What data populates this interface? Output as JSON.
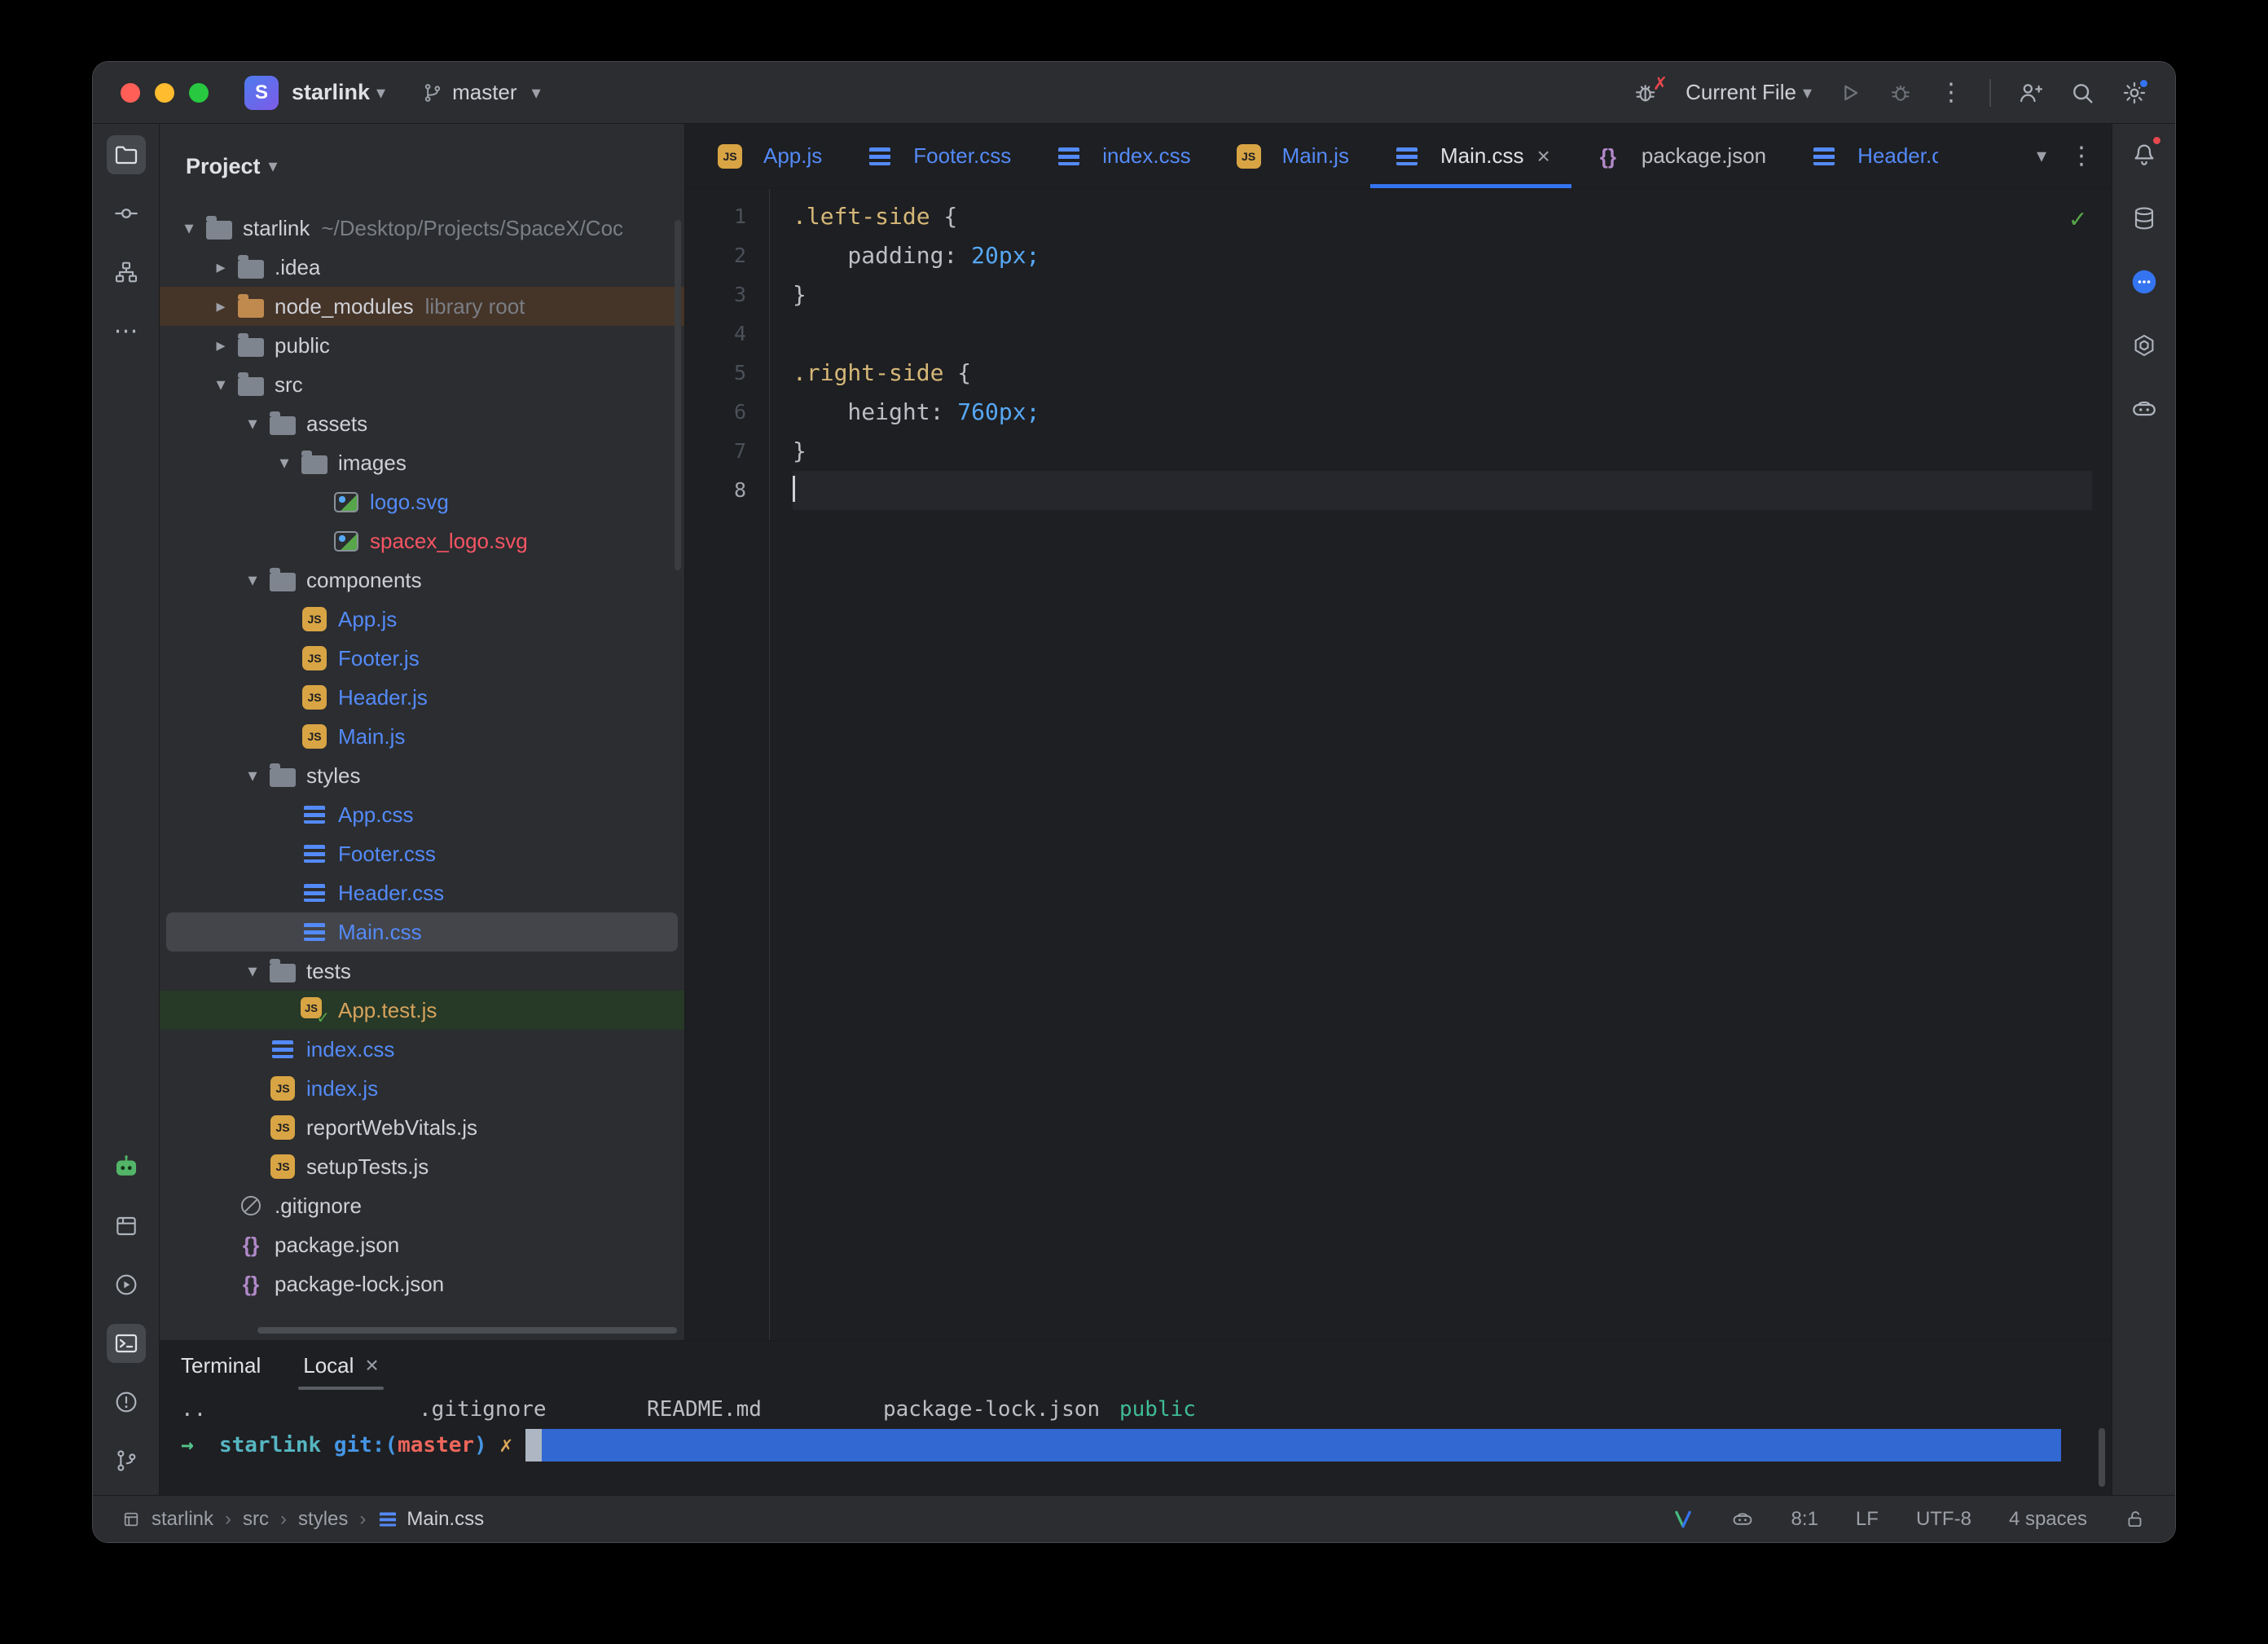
{
  "titlebar": {
    "project_initial": "S",
    "project_name": "starlink",
    "branch_name": "master",
    "run_config": "Current File"
  },
  "project_panel": {
    "title": "Project",
    "tree": [
      {
        "label": "starlink",
        "suffix": "~/Desktop/Projects/SpaceX/Coc"
      },
      {
        "label": ".idea"
      },
      {
        "label": "node_modules",
        "suffix": "library root"
      },
      {
        "label": "public"
      },
      {
        "label": "src"
      },
      {
        "label": "assets"
      },
      {
        "label": "images"
      },
      {
        "label": "logo.svg"
      },
      {
        "label": "spacex_logo.svg"
      },
      {
        "label": "components"
      },
      {
        "label": "App.js"
      },
      {
        "label": "Footer.js"
      },
      {
        "label": "Header.js"
      },
      {
        "label": "Main.js"
      },
      {
        "label": "styles"
      },
      {
        "label": "App.css"
      },
      {
        "label": "Footer.css"
      },
      {
        "label": "Header.css"
      },
      {
        "label": "Main.css"
      },
      {
        "label": "tests"
      },
      {
        "label": "App.test.js"
      },
      {
        "label": "index.css"
      },
      {
        "label": "index.js"
      },
      {
        "label": "reportWebVitals.js"
      },
      {
        "label": "setupTests.js"
      },
      {
        "label": ".gitignore"
      },
      {
        "label": "package.json"
      },
      {
        "label": "package-lock.json"
      }
    ]
  },
  "tabs": [
    {
      "label": "App.js"
    },
    {
      "label": "Footer.css"
    },
    {
      "label": "index.css"
    },
    {
      "label": "Main.js"
    },
    {
      "label": "Main.css"
    },
    {
      "label": "package.json"
    },
    {
      "label": "Header.cs"
    }
  ],
  "editor": {
    "line_numbers": [
      "1",
      "2",
      "3",
      "4",
      "5",
      "6",
      "7",
      "8"
    ],
    "code": {
      "selector_1": ".left-side",
      "open_brace_1": "{",
      "property_1": "padding:",
      "value_1": "20px;",
      "close_brace_1": "}",
      "selector_2": ".right-side",
      "open_brace_2": "{",
      "property_2": "height:",
      "value_2": "760px;",
      "close_brace_2": "}"
    }
  },
  "terminal": {
    "panel_tab": "Terminal",
    "session_tab": "Local",
    "listing": [
      "..",
      ".gitignore",
      "README.md",
      "package-lock.json",
      "public"
    ],
    "prompt": {
      "arrow": "→",
      "dir": "starlink",
      "git_open": "git:(",
      "branch": "master",
      "git_close": ")",
      "dirty_mark": "✗"
    }
  },
  "status_bar": {
    "breadcrumbs": [
      "starlink",
      "src",
      "styles",
      "Main.css"
    ],
    "caret_position": "8:1",
    "line_separator": "LF",
    "encoding": "UTF-8",
    "indent_style": "4 spaces"
  },
  "colors": {
    "accent_blue": "#3574F0",
    "vcs_modified_blue": "#548AF7",
    "vcs_untracked_red": "#F75464",
    "terminal_dir_green": "#3FBC97"
  }
}
